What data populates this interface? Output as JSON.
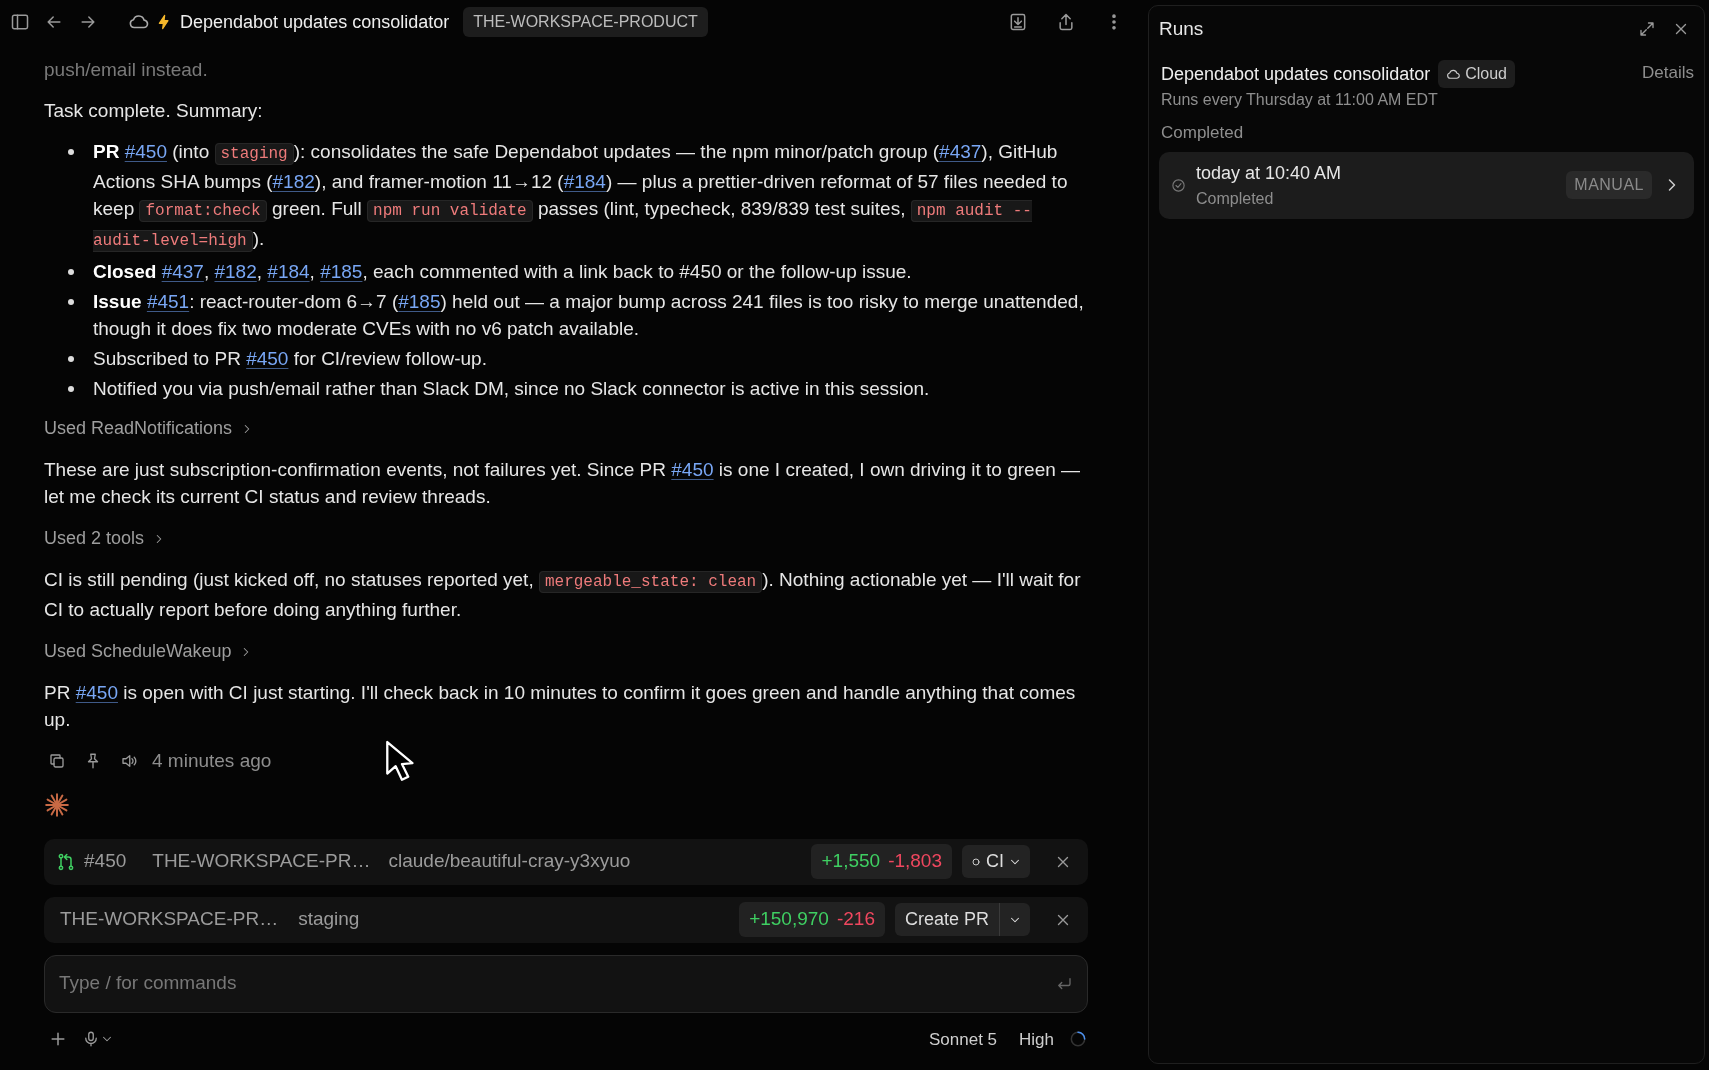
{
  "header": {
    "title": "Dependabot updates consolidator",
    "workspace": "THE-WORKSPACE-PRODUCT"
  },
  "messages": [
    {
      "kind": "paragraph",
      "faded": true,
      "segments": [
        {
          "kind": "text",
          "text": "push/email instead."
        }
      ]
    },
    {
      "kind": "paragraph",
      "faded": false,
      "segments": [
        {
          "kind": "text",
          "text": "Task complete. Summary:"
        }
      ]
    },
    {
      "kind": "bullets",
      "items": [
        [
          {
            "kind": "bold",
            "text": "PR "
          },
          {
            "kind": "link",
            "text": "#450"
          },
          {
            "kind": "text",
            "text": " (into "
          },
          {
            "kind": "code",
            "text": "staging"
          },
          {
            "kind": "text",
            "text": "): consolidates the safe Dependabot updates — the npm minor/patch group ("
          },
          {
            "kind": "link",
            "text": "#437"
          },
          {
            "kind": "text",
            "text": "), GitHub Actions SHA bumps ("
          },
          {
            "kind": "link",
            "text": "#182"
          },
          {
            "kind": "text",
            "text": "), and framer-motion 11→12 ("
          },
          {
            "kind": "link",
            "text": "#184"
          },
          {
            "kind": "text",
            "text": ") — plus a prettier-driven reformat of 57 files needed to keep "
          },
          {
            "kind": "code",
            "text": "format:check"
          },
          {
            "kind": "text",
            "text": " green. Full "
          },
          {
            "kind": "code",
            "text": "npm run validate"
          },
          {
            "kind": "text",
            "text": " passes (lint, typecheck, 839/839 test suites, "
          },
          {
            "kind": "code",
            "text": "npm audit --audit-level=high"
          },
          {
            "kind": "text",
            "text": ")."
          }
        ],
        [
          {
            "kind": "bold",
            "text": "Closed "
          },
          {
            "kind": "link",
            "text": "#437"
          },
          {
            "kind": "text",
            "text": ", "
          },
          {
            "kind": "link",
            "text": "#182"
          },
          {
            "kind": "text",
            "text": ", "
          },
          {
            "kind": "link",
            "text": "#184"
          },
          {
            "kind": "text",
            "text": ", "
          },
          {
            "kind": "link",
            "text": "#185"
          },
          {
            "kind": "text",
            "text": ", each commented with a link back to #450 or the follow-up issue."
          }
        ],
        [
          {
            "kind": "bold",
            "text": "Issue "
          },
          {
            "kind": "link",
            "text": "#451"
          },
          {
            "kind": "text",
            "text": ": react-router-dom 6→7 ("
          },
          {
            "kind": "link",
            "text": "#185"
          },
          {
            "kind": "text",
            "text": ") held out — a major bump across 241 files is too risky to merge unattended, though it does fix two moderate CVEs with no v6 patch available."
          }
        ],
        [
          {
            "kind": "text",
            "text": "Subscribed to PR "
          },
          {
            "kind": "link",
            "text": "#450"
          },
          {
            "kind": "text",
            "text": " for CI/review follow-up."
          }
        ],
        [
          {
            "kind": "text",
            "text": "Notified you via push/email rather than Slack DM, since no Slack connector is active in this session."
          }
        ]
      ]
    },
    {
      "kind": "tool",
      "text": "Used ReadNotifications"
    },
    {
      "kind": "paragraph",
      "faded": false,
      "segments": [
        {
          "kind": "text",
          "text": "These are just subscription-confirmation events, not failures yet. Since PR "
        },
        {
          "kind": "link",
          "text": "#450"
        },
        {
          "kind": "text",
          "text": " is one I created, I own driving it to green — let me check its current CI status and review threads."
        }
      ]
    },
    {
      "kind": "tool",
      "text": "Used 2 tools"
    },
    {
      "kind": "paragraph",
      "faded": false,
      "segments": [
        {
          "kind": "text",
          "text": "CI is still pending (just kicked off, no statuses reported yet, "
        },
        {
          "kind": "code",
          "text": "mergeable_state: clean"
        },
        {
          "kind": "text",
          "text": "). Nothing actionable yet — I'll wait for CI to actually report before doing anything further."
        }
      ]
    },
    {
      "kind": "tool",
      "text": "Used ScheduleWakeup"
    },
    {
      "kind": "paragraph",
      "faded": false,
      "segments": [
        {
          "kind": "text",
          "text": "PR "
        },
        {
          "kind": "link",
          "text": "#450"
        },
        {
          "kind": "text",
          "text": " is open with CI just starting. I'll check back in 10 minutes to confirm it goes green and handle anything that comes up."
        }
      ]
    }
  ],
  "message_meta": {
    "time": "4 minutes ago"
  },
  "pr_card": {
    "number": "#450",
    "repo": "THE-WORKSPACE-PR…",
    "branch": "claude/beautiful-cray-y3xyuo",
    "added": "+1,550",
    "removed": "-1,803",
    "ci": "CI"
  },
  "branch_card": {
    "repo": "THE-WORKSPACE-PR…",
    "branch": "staging",
    "added": "+150,970",
    "removed": "-216",
    "action": "Create PR"
  },
  "composer": {
    "placeholder": "Type / for commands"
  },
  "footer": {
    "model": "Sonnet 5",
    "effort": "High"
  },
  "runs_panel": {
    "title": "Runs",
    "name": "Dependabot updates consolidator",
    "badge": "Cloud",
    "details": "Details",
    "schedule": "Runs every Thursday at 11:00 AM EDT",
    "section": "Completed",
    "runs": [
      {
        "time": "today at 10:40 AM",
        "status": "Completed",
        "trigger": "MANUAL"
      }
    ]
  }
}
